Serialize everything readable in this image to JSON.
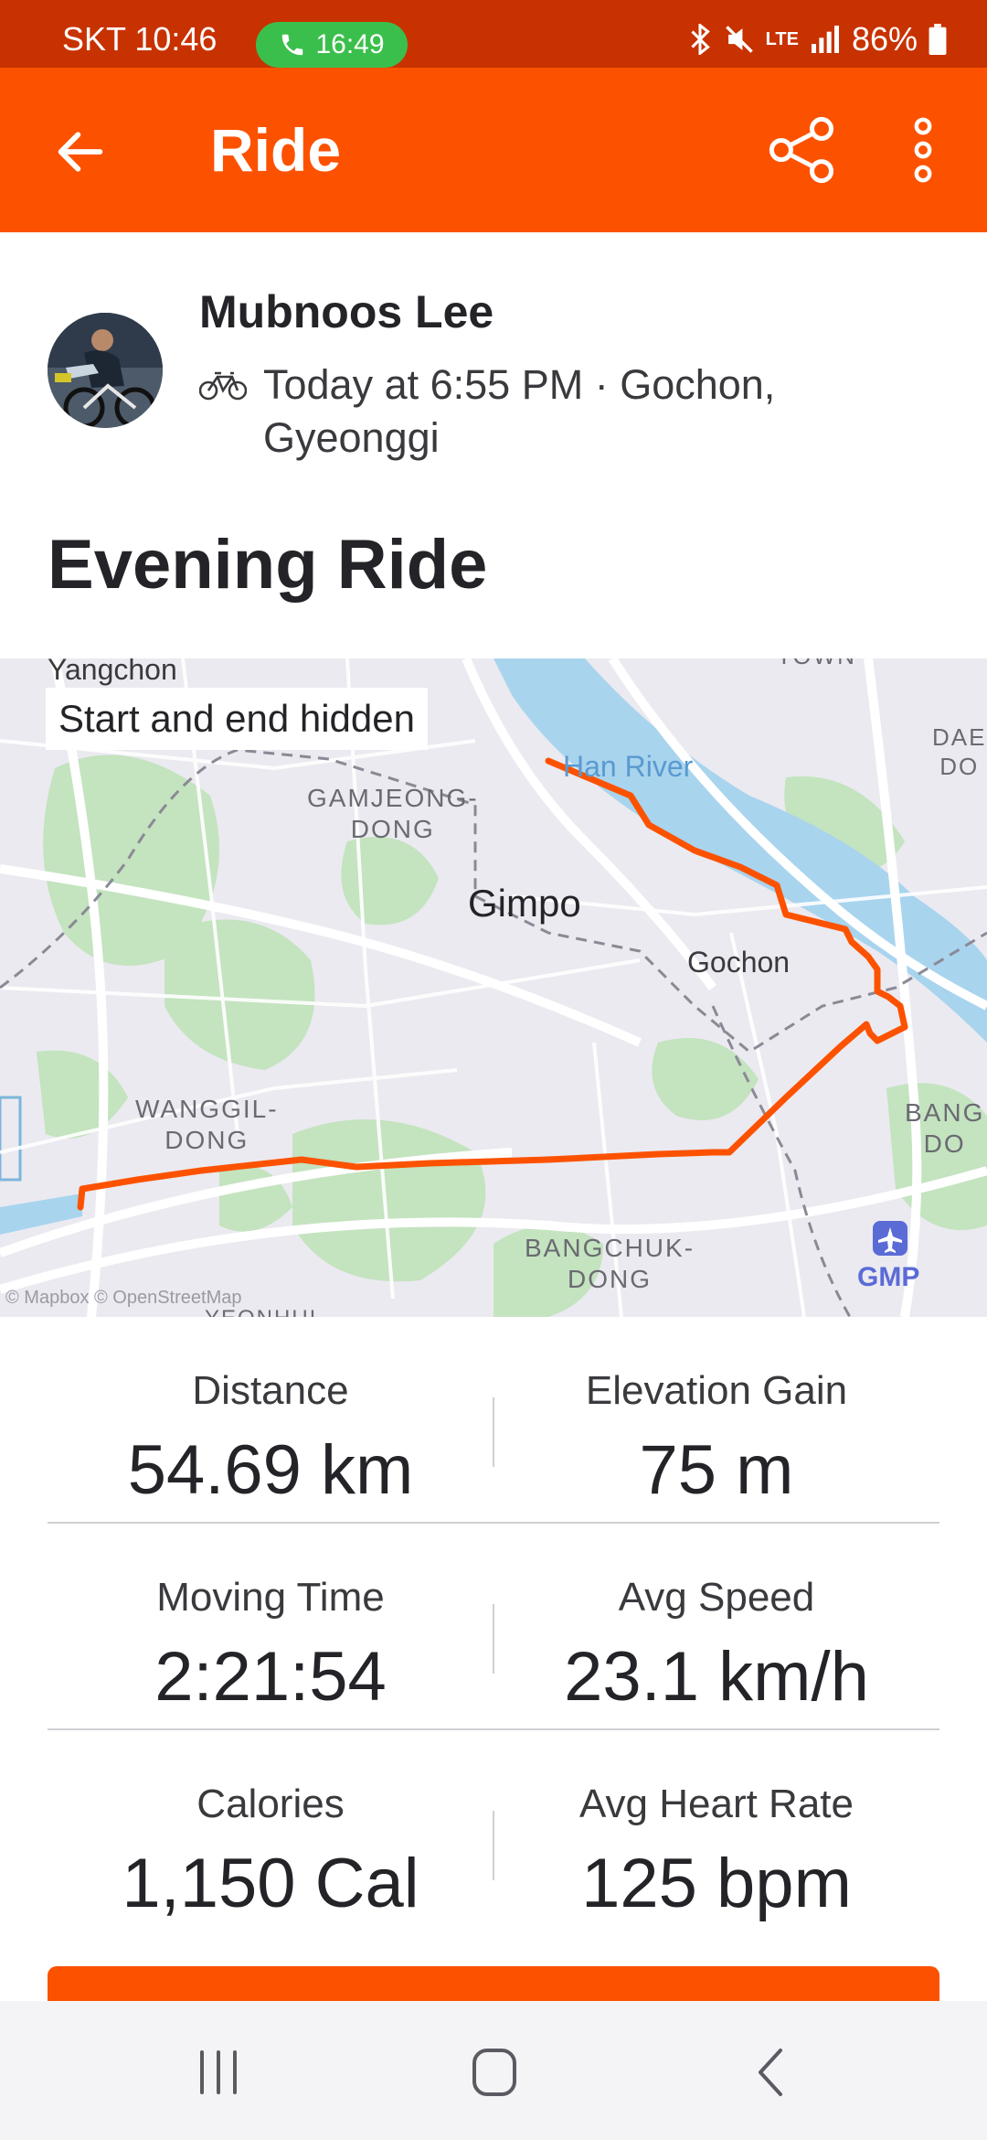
{
  "status_bar": {
    "carrier_time": "SKT 10:46",
    "call_time": "16:49",
    "battery": "86%",
    "network": "LTE"
  },
  "app_bar": {
    "title": "Ride"
  },
  "activity": {
    "athlete_name": "Mubnoos Lee",
    "meta": "Today at 6:55 PM · Gochon, Gyeonggi",
    "title": "Evening Ride"
  },
  "map": {
    "privacy_badge": "Start and end hidden",
    "labels": {
      "yangchon": "Yangchon",
      "han_river": "Han River",
      "gamjeong": "GAMJEONG-\nDONG",
      "gimpo": "Gimpo",
      "gochon": "Gochon",
      "wanggil": "WANGGIL-\nDONG",
      "bangchuk": "BANGCHUK-\nDONG",
      "gmp": "GMP",
      "dae": "DAE\nDO",
      "bang": "BANG\nDO",
      "yeonhui": "YEONHUI",
      "town": "TOWN"
    },
    "copyright": "© Mapbox © OpenStreetMap",
    "route_color": "#fc5200"
  },
  "stats": [
    {
      "label": "Distance",
      "value": "54.69 km"
    },
    {
      "label": "Elevation Gain",
      "value": "75 m"
    },
    {
      "label": "Moving Time",
      "value": "2:21:54"
    },
    {
      "label": "Avg Speed",
      "value": "23.1 km/h"
    },
    {
      "label": "Calories",
      "value": "1,150 Cal"
    },
    {
      "label": "Avg Heart Rate",
      "value": "125 bpm"
    }
  ],
  "colors": {
    "brand": "#fc5200",
    "status_bar": "#c83200",
    "call_pill": "#3bbf4c"
  },
  "icons": {
    "back": "arrow-left-icon",
    "share": "share-icon",
    "more": "more-vertical-icon",
    "bike": "bike-icon",
    "airport": "airplane-icon"
  }
}
